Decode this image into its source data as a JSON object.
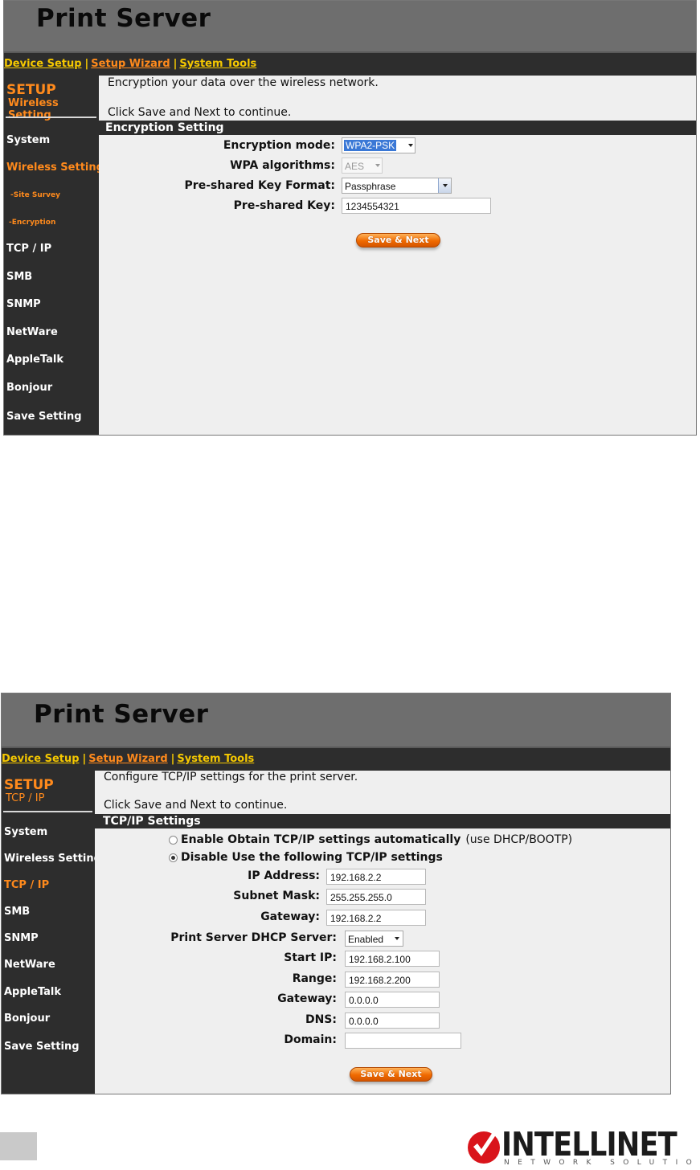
{
  "screens": [
    {
      "app_title": "Print Server",
      "nav": [
        "Device Setup",
        "Setup Wizard",
        "System Tools"
      ],
      "nav_separator": "|",
      "sidebar": {
        "setup": "SETUP",
        "subtitle": "Wireless Setting",
        "items": [
          "System",
          "Wireless Setting",
          "-Site Survey",
          "-Encryption",
          "TCP / IP",
          "SMB",
          "SNMP",
          "NetWare",
          "AppleTalk",
          "Bonjour",
          "Save Setting"
        ]
      },
      "intro_lines": [
        "Encryption your data over the wireless network.",
        "Click Save and Next to continue."
      ],
      "section_title": "Encryption Setting",
      "fields": {
        "encryption_mode_label": "Encryption mode:",
        "encryption_mode_value": "WPA2-PSK",
        "wpa_algorithms_label": "WPA algorithms:",
        "wpa_algorithms_value": "AES",
        "key_format_label": "Pre-shared Key Format:",
        "key_format_value": "Passphrase",
        "key_label": "Pre-shared Key:",
        "key_value": "1234554321"
      },
      "button": "Save & Next"
    },
    {
      "app_title": "Print Server",
      "nav": [
        "Device Setup",
        "Setup Wizard",
        "System Tools"
      ],
      "nav_separator": "|",
      "sidebar": {
        "setup": "SETUP",
        "subtitle": "TCP / IP",
        "items": [
          "System",
          "Wireless Setting",
          "TCP / IP",
          "SMB",
          "SNMP",
          "NetWare",
          "AppleTalk",
          "Bonjour",
          "Save Setting"
        ]
      },
      "intro_lines": [
        "Configure TCP/IP settings for the print server.",
        "Click Save and Next to continue."
      ],
      "section_title": "TCP/IP Settings",
      "radios": {
        "enable_label": "Enable Obtain TCP/IP settings automatically",
        "enable_note": "(use DHCP/BOOTP)",
        "disable_label": "Disable Use the following TCP/IP settings",
        "selected": "disable"
      },
      "fields": {
        "ip_label": "IP Address:",
        "ip_value": "192.168.2.2",
        "mask_label": "Subnet Mask:",
        "mask_value": "255.255.255.0",
        "gateway_label": "Gateway:",
        "gateway_value": "192.168.2.2",
        "dhcp_label": "Print Server DHCP Server:",
        "dhcp_value": "Enabled",
        "start_ip_label": "Start IP:",
        "start_ip_value": "192.168.2.100",
        "range_label": "Range:",
        "range_value": "192.168.2.200",
        "dhcp_gateway_label": "Gateway:",
        "dhcp_gateway_value": "0.0.0.0",
        "dns_label": "DNS:",
        "dns_value": "0.0.0.0",
        "domain_label": "Domain:",
        "domain_value": ""
      },
      "button": "Save & Next"
    }
  ],
  "footer": {
    "brand": "INTELLINET",
    "tagline": "NETWORK SOLUTIONS",
    "brand_mark_icon": "intellinet-checkmark-logo-icon"
  },
  "colors": {
    "title_bar": "#6e6e6e",
    "dark_panel": "#2d2d2d",
    "accent_orange": "#ff8a1c",
    "nav_yellow": "#f5c800",
    "content_bg": "#efefef",
    "logo_red": "#d9141b"
  }
}
